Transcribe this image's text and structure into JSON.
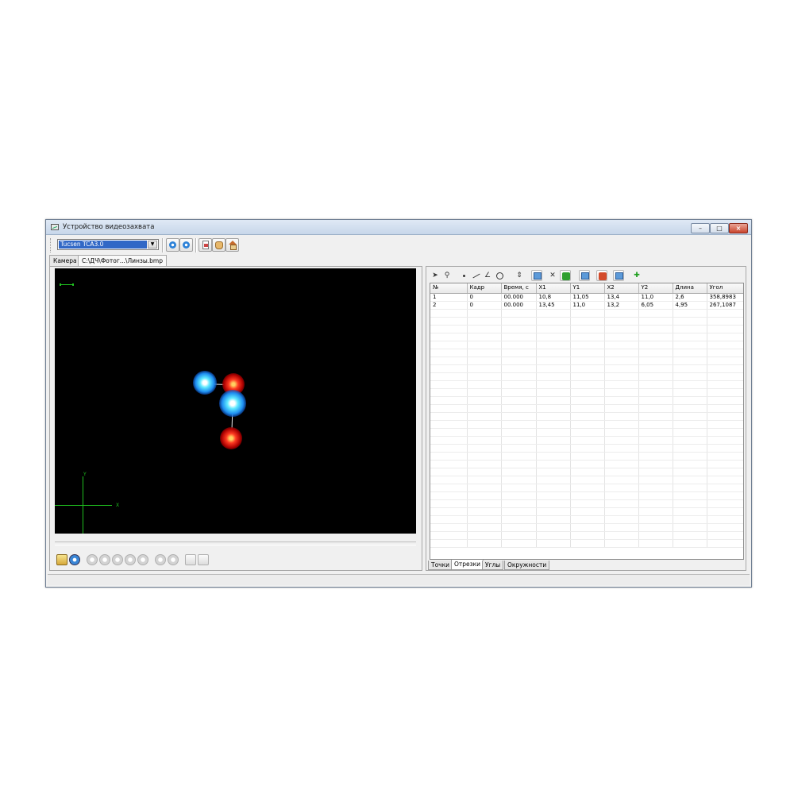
{
  "window": {
    "title": "Устройство видеозахвата"
  },
  "toolbar": {
    "camera_selected": "Tucsen TCA3.0",
    "combo_arrow": "▼"
  },
  "file_tabs": [
    {
      "label": "Камера"
    },
    {
      "label": "C:\\ДЧ\\Фотог...\\Линзы.bmp"
    }
  ],
  "video": {
    "axis_x_label": "X",
    "axis_y_label": "Y"
  },
  "colors": {
    "video_bg": "#000000",
    "overlay_green": "#1fbf1f",
    "selection_blue": "#3168c6"
  },
  "table": {
    "columns": [
      "№",
      "Кадр",
      "Время, с",
      "X1",
      "Y1",
      "X2",
      "Y2",
      "Длина",
      "Угол"
    ],
    "rows": [
      [
        "1",
        "0",
        "00.000",
        "10,8",
        "11,05",
        "13,4",
        "11,0",
        "2,6",
        "358,8983"
      ],
      [
        "2",
        "0",
        "00.000",
        "13,45",
        "11,0",
        "13,2",
        "6,05",
        "4,95",
        "267,1087"
      ]
    ]
  },
  "bottom_tabs": [
    {
      "label": "Точки"
    },
    {
      "label": "Отрезки"
    },
    {
      "label": "Углы"
    },
    {
      "label": "Окружности"
    }
  ]
}
